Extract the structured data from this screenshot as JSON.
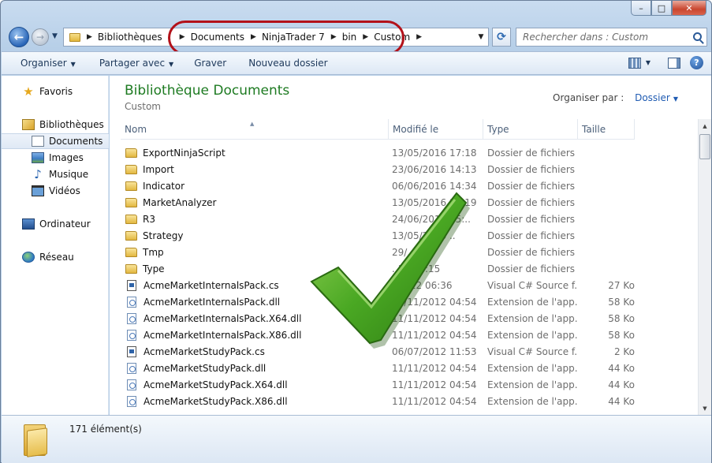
{
  "window": {
    "caption": {
      "minimize": "–",
      "maximize": "□",
      "close": "✕"
    }
  },
  "nav": {
    "back_glyph": "←",
    "forward_glyph": "→",
    "breadcrumb": [
      "Bibliothèques",
      "Documents",
      "NinjaTrader 7",
      "bin",
      "Custom"
    ],
    "search_placeholder": "Rechercher dans : Custom",
    "highlight_color": "#b3121a"
  },
  "toolbar": {
    "organize": "Organiser",
    "share": "Partager avec",
    "burn": "Graver",
    "new_folder": "Nouveau dossier",
    "help": "?"
  },
  "sidebar": {
    "items": [
      {
        "label": "Favoris",
        "icon": "star-icon"
      },
      {
        "label": "Bibliothèques",
        "icon": "libraries-icon"
      },
      {
        "label": "Documents",
        "icon": "documents-icon",
        "selected": true
      },
      {
        "label": "Images",
        "icon": "images-icon"
      },
      {
        "label": "Musique",
        "icon": "music-icon"
      },
      {
        "label": "Vidéos",
        "icon": "videos-icon"
      },
      {
        "label": "Ordinateur",
        "icon": "computer-icon"
      },
      {
        "label": "Réseau",
        "icon": "network-icon"
      }
    ]
  },
  "main": {
    "title": "Bibliothèque Documents",
    "subtitle": "Custom",
    "arrange_label": "Organiser par :",
    "arrange_value": "Dossier",
    "title_color": "#1e7b22",
    "columns": [
      "Nom",
      "Modifié le",
      "Type",
      "Taille"
    ],
    "rows": [
      {
        "name": "ExportNinjaScript",
        "date": "13/05/2016 17:18",
        "type": "Dossier de fichiers",
        "size": "",
        "kind": "folder"
      },
      {
        "name": "Import",
        "date": "23/06/2016 14:13",
        "type": "Dossier de fichiers",
        "size": "",
        "kind": "folder"
      },
      {
        "name": "Indicator",
        "date": "06/06/2016 14:34",
        "type": "Dossier de fichiers",
        "size": "",
        "kind": "folder"
      },
      {
        "name": "MarketAnalyzer",
        "date": "13/05/2016 17:19",
        "type": "Dossier de fichiers",
        "size": "",
        "kind": "folder"
      },
      {
        "name": "R3",
        "date": "24/06/2016 15:..",
        "type": "Dossier de fichiers",
        "size": "",
        "kind": "folder"
      },
      {
        "name": "Strategy",
        "date": "13/05/2016 ..",
        "type": "Dossier de fichiers",
        "size": "",
        "kind": "folder"
      },
      {
        "name": "Tmp",
        "date": "29/..",
        "type": "Dossier de fichiers",
        "size": "",
        "kind": "folder"
      },
      {
        "name": "Type",
        "date": "..16 17:15",
        "type": "Dossier de fichiers",
        "size": "",
        "kind": "folder"
      },
      {
        "name": "AcmeMarketInternalsPack.cs",
        "date": "..2012 06:36",
        "type": "Visual C# Source f...",
        "size": "27 Ko",
        "kind": "cs"
      },
      {
        "name": "AcmeMarketInternalsPack.dll",
        "date": "11/11/2012 04:54",
        "type": "Extension de l'app...",
        "size": "58 Ko",
        "kind": "dll"
      },
      {
        "name": "AcmeMarketInternalsPack.X64.dll",
        "date": "11/11/2012 04:54",
        "type": "Extension de l'app...",
        "size": "58 Ko",
        "kind": "dll"
      },
      {
        "name": "AcmeMarketInternalsPack.X86.dll",
        "date": "11/11/2012 04:54",
        "type": "Extension de l'app...",
        "size": "58 Ko",
        "kind": "dll"
      },
      {
        "name": "AcmeMarketStudyPack.cs",
        "date": "06/07/2012 11:53",
        "type": "Visual C# Source f...",
        "size": "2 Ko",
        "kind": "cs"
      },
      {
        "name": "AcmeMarketStudyPack.dll",
        "date": "11/11/2012 04:54",
        "type": "Extension de l'app...",
        "size": "44 Ko",
        "kind": "dll"
      },
      {
        "name": "AcmeMarketStudyPack.X64.dll",
        "date": "11/11/2012 04:54",
        "type": "Extension de l'app...",
        "size": "44 Ko",
        "kind": "dll"
      },
      {
        "name": "AcmeMarketStudyPack.X86.dll",
        "date": "11/11/2012 04:54",
        "type": "Extension de l'app...",
        "size": "44 Ko",
        "kind": "dll"
      }
    ]
  },
  "overlay": {
    "checkmark_color": "#3f9e1e"
  },
  "status": {
    "count": "171 élément(s)"
  }
}
